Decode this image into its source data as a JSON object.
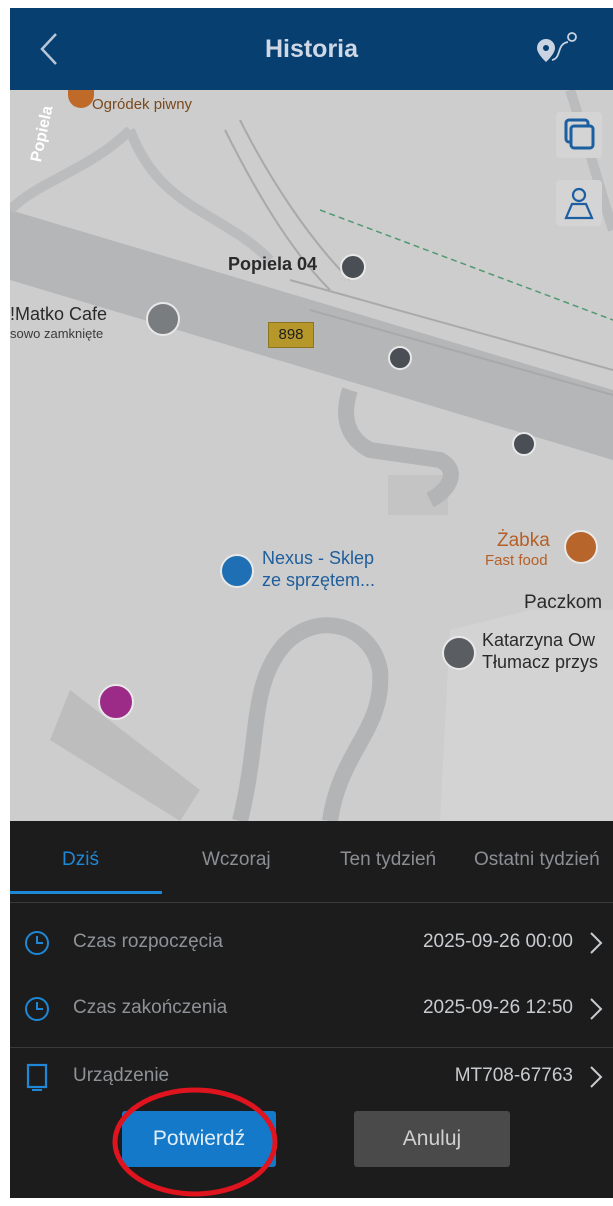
{
  "header": {
    "title": "Historia"
  },
  "map": {
    "places": {
      "ogrodek": "Ogródek piwny",
      "street": "Popiela",
      "stop": "Popiela 04",
      "cafe_name": "!Matko Cafe",
      "cafe_status": "sowo zamknięte",
      "road_number": "898",
      "zabka_name": "Żabka",
      "zabka_type": "Fast food",
      "nexus_line1": "Nexus - Sklep",
      "nexus_line2": "ze sprzętem...",
      "paczkom": "Paczkom",
      "katarzyna_line1": "Katarzyna Ow",
      "katarzyna_line2": "Tłumacz przys"
    }
  },
  "tabs": [
    "Dziś",
    "Wczoraj",
    "Ten tydzień",
    "Ostatni tydzień"
  ],
  "rows": {
    "start": {
      "label": "Czas rozpoczęcia",
      "value": "2025-09-26 00:00"
    },
    "end": {
      "label": "Czas zakończenia",
      "value": "2025-09-26 12:50"
    },
    "device": {
      "label": "Urządzenie",
      "value": "MT708-67763"
    }
  },
  "buttons": {
    "confirm": "Potwierdź",
    "cancel": "Anuluj"
  },
  "colors": {
    "header": "#073f70",
    "accent": "#1e88d6",
    "panel": "#1c1c1c",
    "highlight": "#e0141e"
  }
}
